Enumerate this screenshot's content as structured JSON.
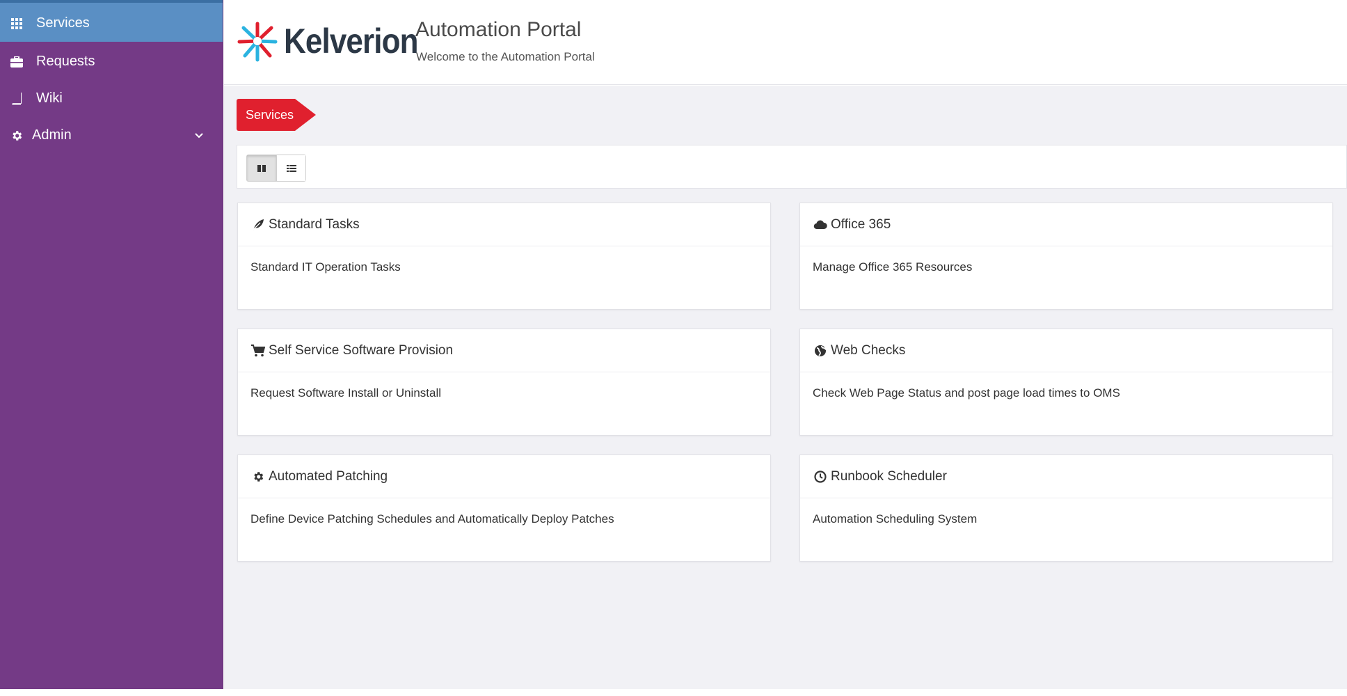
{
  "sidebar": {
    "items": [
      {
        "label": "Services",
        "icon": "grid-icon",
        "active": true
      },
      {
        "label": "Requests",
        "icon": "briefcase-icon"
      },
      {
        "label": "Wiki",
        "icon": "book-icon"
      },
      {
        "label": "Admin",
        "icon": "gear-icon",
        "has_submenu": true
      }
    ]
  },
  "header": {
    "logo_text": "Kelverion",
    "title": "Automation Portal",
    "subtitle": "Welcome to the Automation Portal"
  },
  "breadcrumb": {
    "label": "Services"
  },
  "toolbar": {
    "views": [
      "grid-view",
      "list-view"
    ],
    "selected": "grid-view"
  },
  "cards": [
    {
      "title": "Standard Tasks",
      "icon": "leaf-icon",
      "description": "Standard IT Operation Tasks"
    },
    {
      "title": "Office 365",
      "icon": "cloud-icon",
      "description": "Manage Office 365 Resources"
    },
    {
      "title": "Self Service Software Provision",
      "icon": "cart-icon",
      "description": "Request Software Install or Uninstall"
    },
    {
      "title": "Web Checks",
      "icon": "globe-icon",
      "description": "Check Web Page Status and post page load times to OMS"
    },
    {
      "title": "Automated Patching",
      "icon": "gear-icon",
      "description": "Define Device Patching Schedules and Automatically Deploy Patches"
    },
    {
      "title": "Runbook Scheduler",
      "icon": "clock-icon",
      "description": "Automation Scheduling System"
    }
  ],
  "colors": {
    "sidebar": "#743a86",
    "active_nav": "#5a8fc4",
    "breadcrumb": "#e0202e",
    "content_bg": "#f1f1f5"
  }
}
